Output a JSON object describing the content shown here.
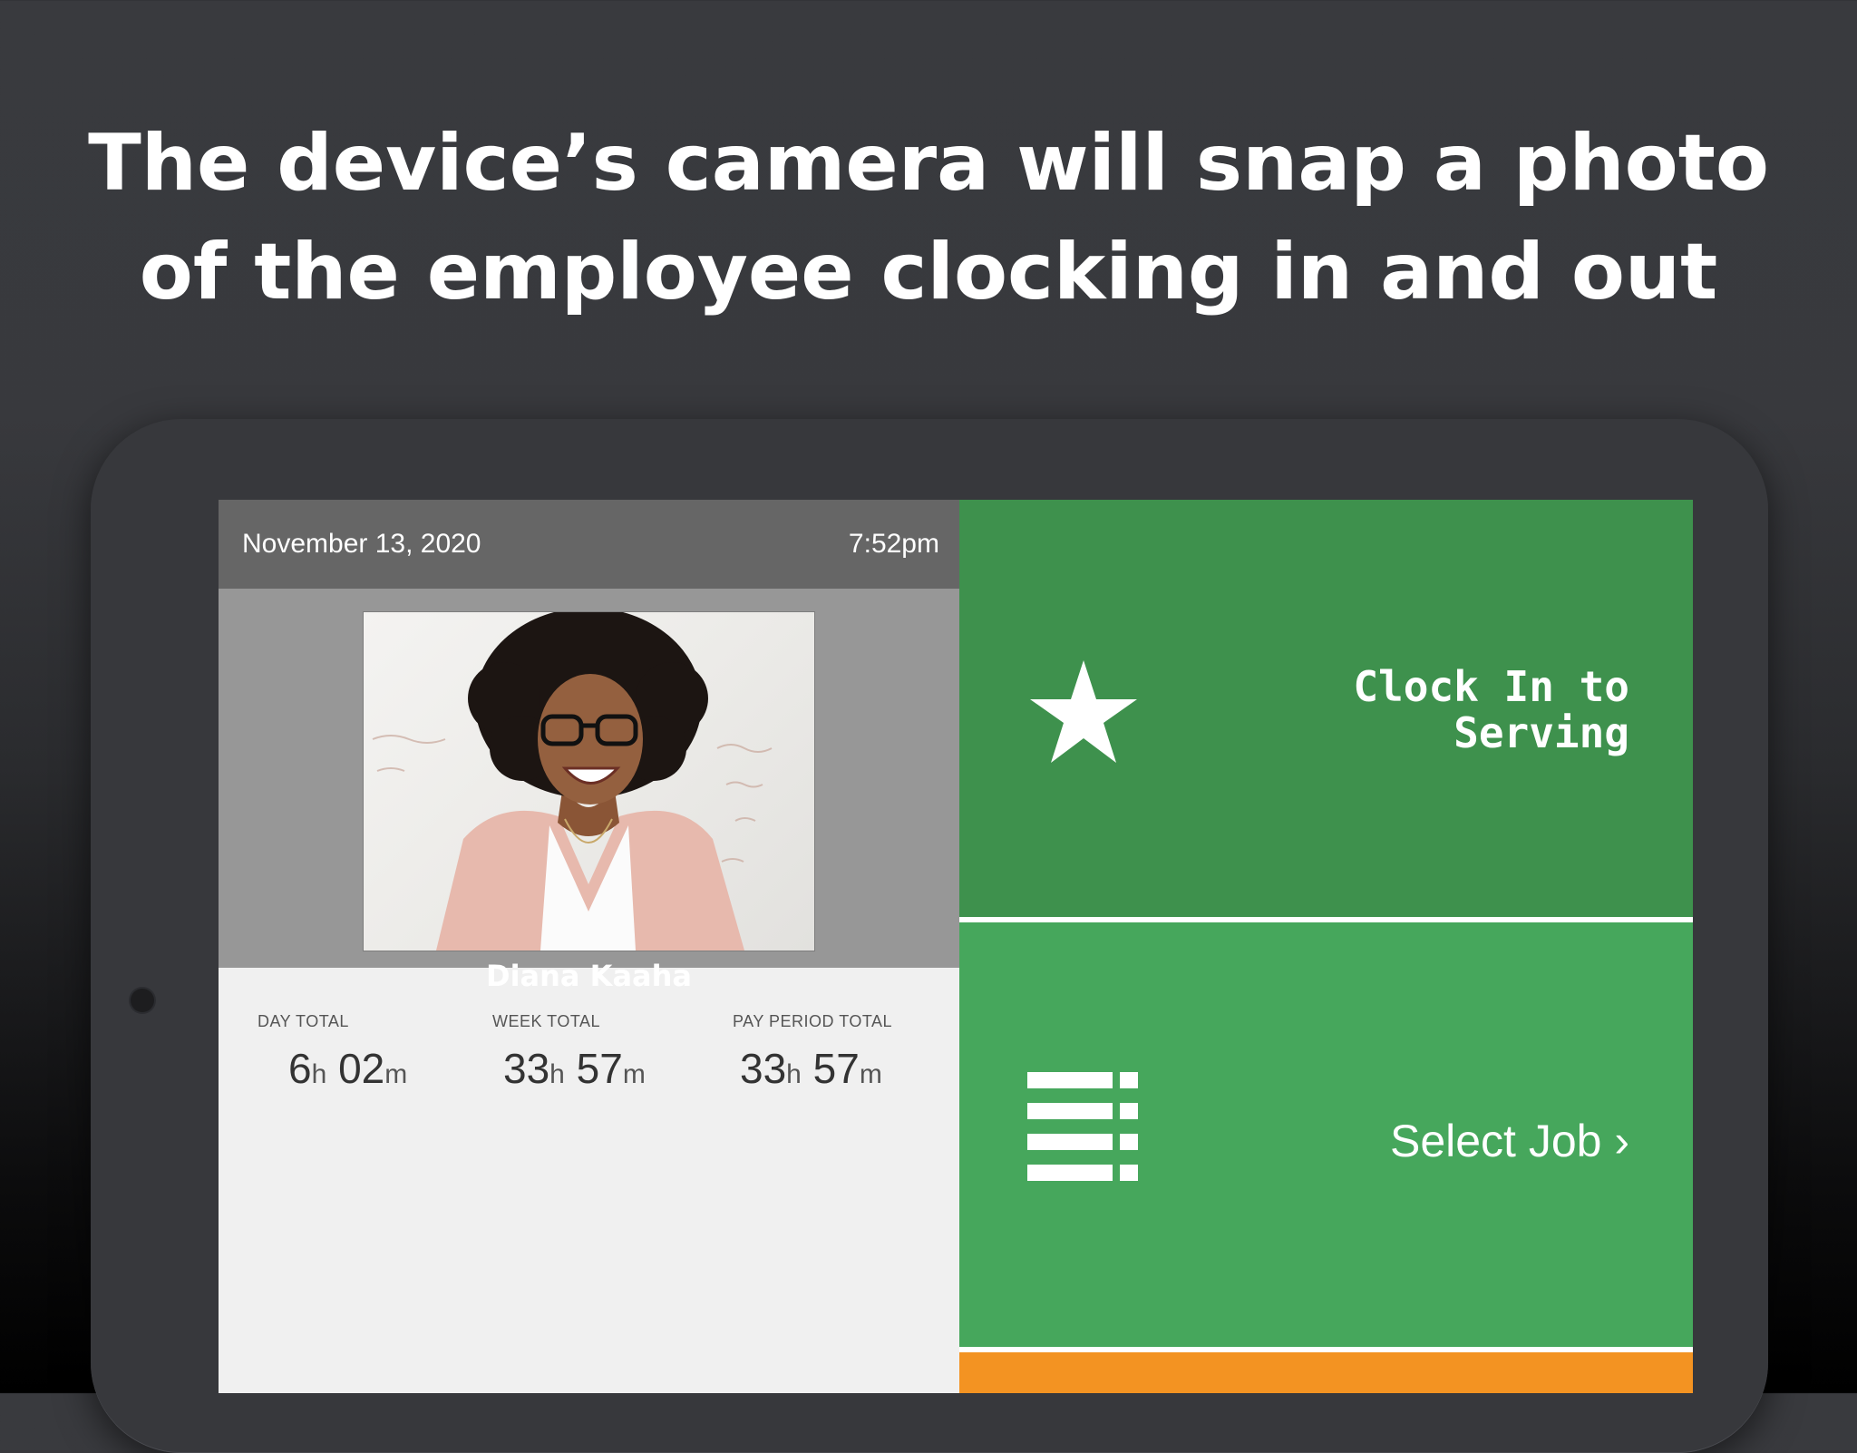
{
  "headline": {
    "line1": "The device’s camera will snap a photo",
    "line2": "of the employee clocking in and out"
  },
  "header": {
    "date": "November 13, 2020",
    "time": "7:52pm"
  },
  "employee": {
    "name": "Diana Kaaha"
  },
  "totals": [
    {
      "label": "DAY TOTAL",
      "hours": "6",
      "hours_unit": "h",
      "minutes": "02",
      "minutes_unit": "m"
    },
    {
      "label": "WEEK TOTAL",
      "hours": "33",
      "hours_unit": "h",
      "minutes": "57",
      "minutes_unit": "m"
    },
    {
      "label": "PAY PERIOD TOTAL",
      "hours": "33",
      "hours_unit": "h",
      "minutes": "57",
      "minutes_unit": "m"
    }
  ],
  "actions": {
    "clock_in_line1": "Clock In to",
    "clock_in_line2": "Serving",
    "select_job": "Select Job ›"
  },
  "colors": {
    "clock_in_bg": "#3e914d",
    "select_job_bg": "#46a75c",
    "bottom_button_bg": "#f39322",
    "header_bar": "#666666",
    "profile_bg": "#979797"
  },
  "icons": {
    "clock_in": "star-icon",
    "select_job": "list-icon"
  }
}
